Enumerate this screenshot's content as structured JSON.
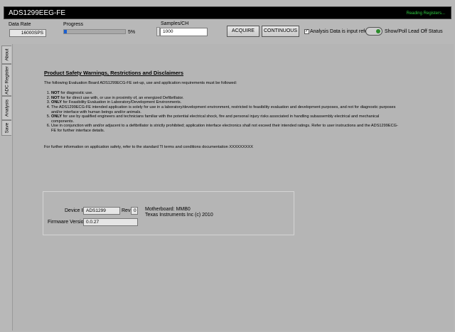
{
  "window": {
    "title": "ADS1299EEG-FE",
    "status": "Reading Registers..."
  },
  "controls": {
    "data_rate_label": "Data Rate",
    "data_rate_value": "16000SPS",
    "progress_label": "Progress",
    "progress_percent": 5,
    "progress_text": "5%",
    "samples_label": "Samples/CH",
    "samples_value": "1000",
    "acquire": "ACQUIRE",
    "continuous": "CONTINUOUS",
    "input_referred_label": "Analysis Data is input referred",
    "input_referred_checked": true,
    "lead_off_label": "Show/Poll Lead Off Status"
  },
  "tabs": [
    {
      "label": "About"
    },
    {
      "label": "ADC Register"
    },
    {
      "label": "Analysis"
    },
    {
      "label": "Save"
    }
  ],
  "doc": {
    "heading": "Product Safety Warnings, Restrictions and Disclaimers",
    "intro": "The following Evaluation Board ADS1299ECG-FE set-up, use and application requirements must be followed:",
    "items": [
      {
        "bold": "NOT",
        "text": " for diagnostic use."
      },
      {
        "bold": "NOT",
        "text": " for for direct use with, or use in proximity of, an energized Defibrillator."
      },
      {
        "bold": "ONLY",
        "text": " for Feasibility Evaluation in Laboratory/Development Environments."
      },
      {
        "bold": "",
        "text": "The ADS1299ECG-FE intended application is solely for use in a laboratory/development environment, restricted to feasibility evaluation and development purposes, and not for diagnostic purposes and/or interface with human beings and/or animals."
      },
      {
        "bold": "ONLY",
        "text": " for use by qualified engineers and technicians familiar with the potential electrical shock, fire and personal injury risks associated in handling subassembly electrical and mechanical components."
      },
      {
        "bold": "",
        "text": "Use in conjunction with and/or adjacent to a defibrillator is strictly prohibited; application interface electronics shall not exceed their intended ratings. Refer to user instructions and the ADS1299ECG-FE for further interface details."
      }
    ],
    "footer": "For further information on application safety, refer to the standard TI terms and conditions documentation XXXXXXXXX"
  },
  "device": {
    "device_id_label": "Device ID",
    "device_id": "ADS1299",
    "rev_label": "Rev",
    "rev": "0",
    "firmware_label": "Firmware Version",
    "firmware": "0.0.27",
    "motherboard": "Motherboard:  MMB0",
    "company": "Texas Instruments Inc (c) 2010"
  }
}
